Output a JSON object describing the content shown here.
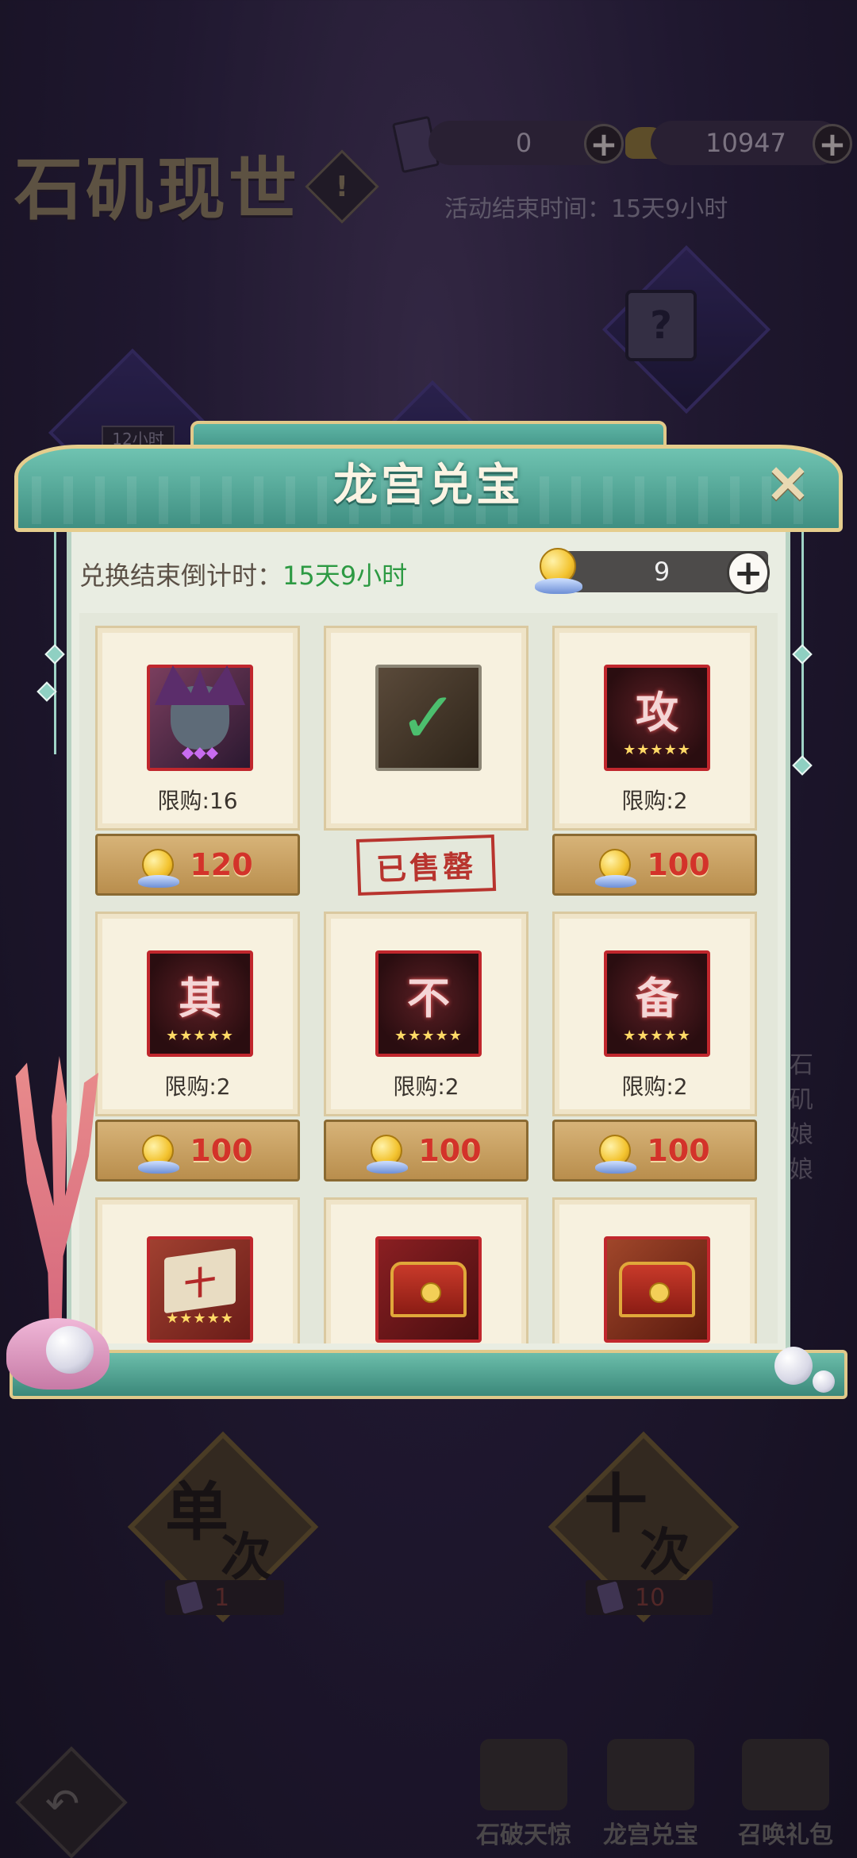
{
  "background": {
    "event_title": "石矶现世",
    "info_icon": "exclamation-icon",
    "tickets": {
      "value": "0",
      "icon": "ticket-icon"
    },
    "gold": {
      "value": "10947",
      "icon": "gold-ingot-icon"
    },
    "event_end": "活动结束时间：15天9小时",
    "card_badge": "12小时",
    "side_text": "石矶娘娘",
    "single_draw": {
      "label_1": "单",
      "label_2": "次",
      "cost": "1"
    },
    "ten_draw": {
      "label_1": "十",
      "label_2": "次",
      "cost": "10"
    },
    "nav": [
      {
        "label": "石破天惊",
        "icon": "stone-breaker-icon"
      },
      {
        "label": "龙宫兑宝",
        "icon": "dragon-palace-icon"
      },
      {
        "label": "召唤礼包",
        "icon": "gift-pack-icon"
      }
    ]
  },
  "dialog": {
    "title": "龙宫兑宝",
    "countdown_label": "兑换结束倒计时：",
    "countdown_value": "15天9小时",
    "coin_balance": "9",
    "close_icon": "close-icon",
    "items": [
      {
        "icon": "hero-portrait",
        "glyph": "",
        "stars": "",
        "limit": "限购:16",
        "price": "120",
        "sold": false
      },
      {
        "icon": "skin-portrait",
        "glyph": "",
        "stars": "",
        "limit": "",
        "price": "",
        "sold": true,
        "sold_label": "已售罄"
      },
      {
        "icon": "token-card",
        "glyph": "攻",
        "stars": "★★★★★",
        "limit": "限购:2",
        "price": "100",
        "sold": false
      },
      {
        "icon": "token-card",
        "glyph": "其",
        "stars": "★★★★★",
        "limit": "限购:2",
        "price": "100",
        "sold": false
      },
      {
        "icon": "token-card",
        "glyph": "不",
        "stars": "★★★★★",
        "limit": "限购:2",
        "price": "100",
        "sold": false
      },
      {
        "icon": "token-card",
        "glyph": "备",
        "stars": "★★★★★",
        "limit": "限购:2",
        "price": "100",
        "sold": false
      },
      {
        "icon": "skill-book",
        "glyph": "十",
        "stars": "★★★★★",
        "limit": "",
        "price": "",
        "sold": false
      },
      {
        "icon": "red-chest",
        "glyph": "",
        "stars": "",
        "limit": "",
        "price": "",
        "sold": false
      },
      {
        "icon": "gold-chest",
        "glyph": "",
        "stars": "",
        "limit": "",
        "price": "",
        "sold": false
      }
    ]
  }
}
